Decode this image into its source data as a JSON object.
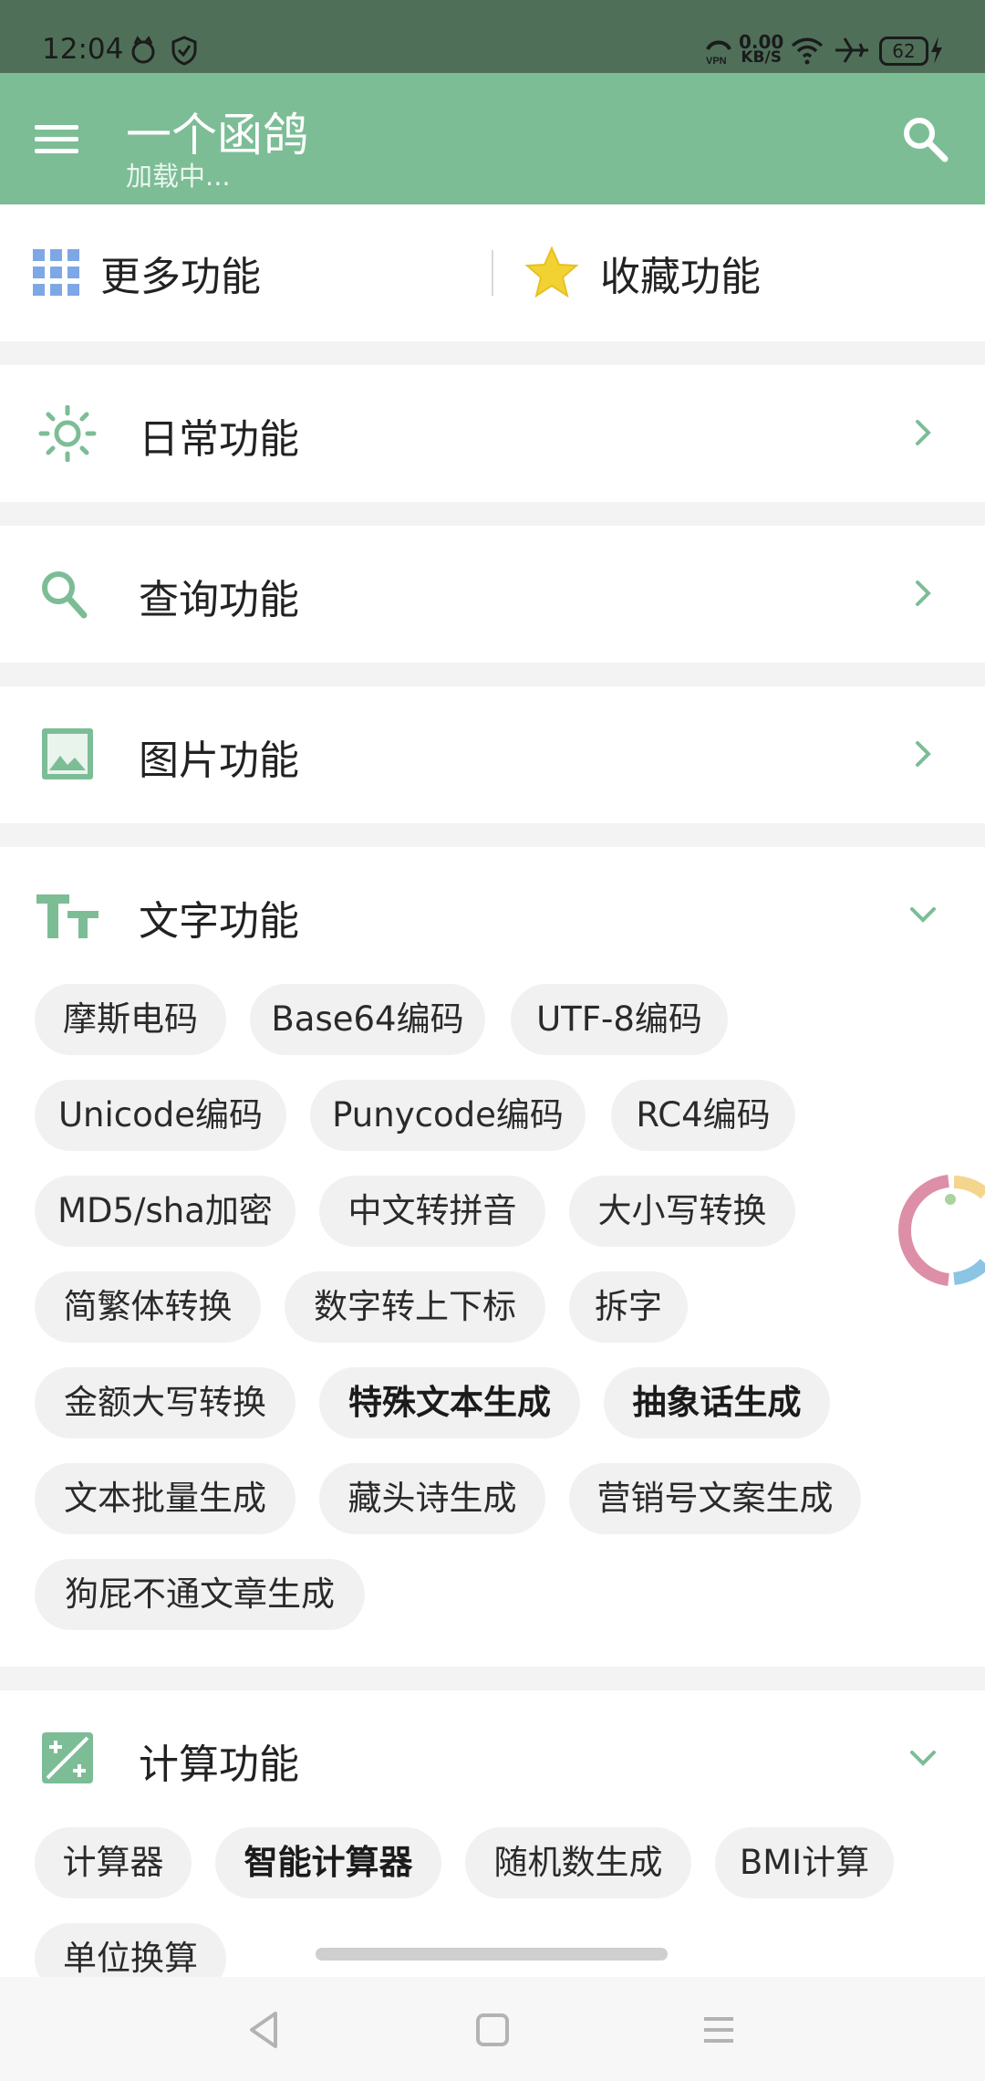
{
  "status_bar": {
    "time": "12:04",
    "network_speed": "0.00",
    "network_unit": "KB/S",
    "battery": "62",
    "vpn_label": "VPN"
  },
  "app_bar": {
    "title": "一个函鸽",
    "subtitle": "加载中..."
  },
  "quick": {
    "more_label": "更多功能",
    "favorites_label": "收藏功能"
  },
  "sections": {
    "daily": {
      "title": "日常功能",
      "expanded": false
    },
    "query": {
      "title": "查询功能",
      "expanded": false
    },
    "image": {
      "title": "图片功能",
      "expanded": false
    },
    "text": {
      "title": "文字功能",
      "expanded": true,
      "chips": [
        {
          "label": "摩斯电码",
          "bold": false
        },
        {
          "label": "Base64编码",
          "bold": false
        },
        {
          "label": "UTF-8编码",
          "bold": false
        },
        {
          "label": "Unicode编码",
          "bold": false
        },
        {
          "label": "Punycode编码",
          "bold": false
        },
        {
          "label": "RC4编码",
          "bold": false
        },
        {
          "label": "MD5/sha加密",
          "bold": false
        },
        {
          "label": "中文转拼音",
          "bold": false
        },
        {
          "label": "大小写转换",
          "bold": false
        },
        {
          "label": "简繁体转换",
          "bold": false
        },
        {
          "label": "数字转上下标",
          "bold": false
        },
        {
          "label": "拆字",
          "bold": false
        },
        {
          "label": "金额大写转换",
          "bold": false
        },
        {
          "label": "特殊文本生成",
          "bold": true
        },
        {
          "label": "抽象话生成",
          "bold": true
        },
        {
          "label": "文本批量生成",
          "bold": false
        },
        {
          "label": "藏头诗生成",
          "bold": false
        },
        {
          "label": "营销号文案生成",
          "bold": false
        },
        {
          "label": "狗屁不通文章生成",
          "bold": false
        }
      ]
    },
    "calc": {
      "title": "计算功能",
      "expanded": true,
      "chips": [
        {
          "label": "计算器",
          "bold": false
        },
        {
          "label": "智能计算器",
          "bold": true
        },
        {
          "label": "随机数生成",
          "bold": false
        },
        {
          "label": "BMI计算",
          "bold": false
        },
        {
          "label": "单位换算",
          "bold": false
        }
      ]
    }
  },
  "colors": {
    "accent": "#7cbd96",
    "status_bar": "#4f6f59",
    "chip_bg": "#f1f1f1",
    "star": "#f2d233",
    "grid_icon": "#7ea7e6"
  }
}
